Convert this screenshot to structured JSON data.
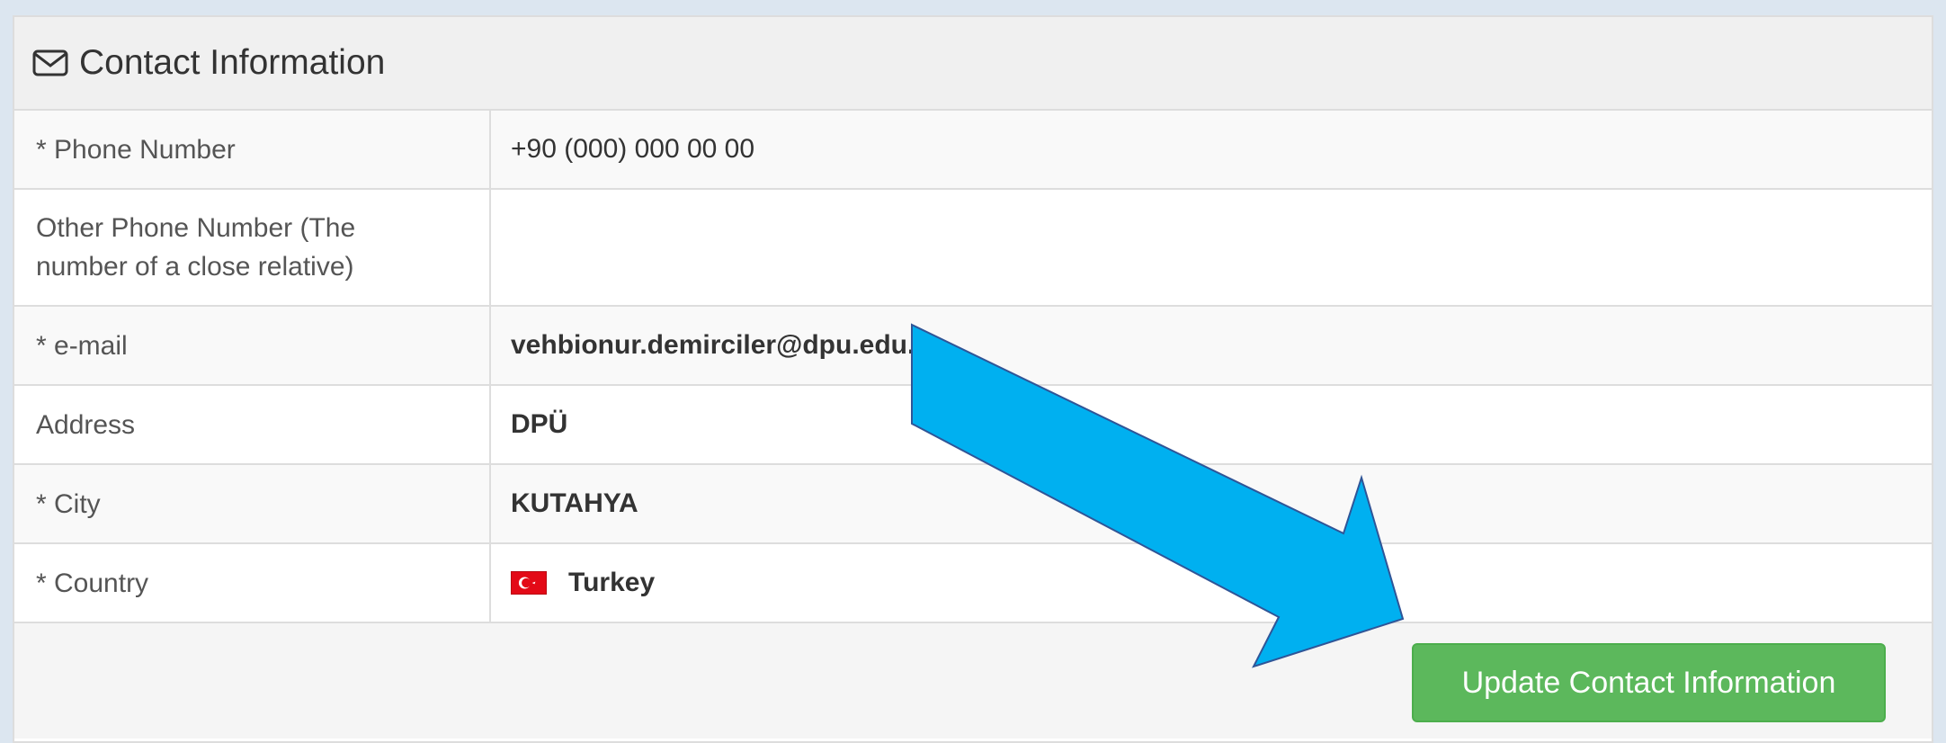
{
  "panel": {
    "title": "Contact Information",
    "icon": "envelope-icon"
  },
  "rows": [
    {
      "label": "* Phone Number",
      "value": "+90 (000) 000 00 00"
    },
    {
      "label": "Other Phone Number (The number of a close relative)",
      "value": ""
    },
    {
      "label": "* e-mail",
      "value": "vehbionur.demirciler@dpu.edu.tr"
    },
    {
      "label": "Address",
      "value": "DPÜ"
    },
    {
      "label": "* City",
      "value": "KUTAHYA"
    },
    {
      "label": "* Country",
      "value": "Turkey",
      "flag_icon": "turkey-flag-icon"
    }
  ],
  "footer": {
    "update_label": "Update Contact Information"
  },
  "colors": {
    "button_green": "#5cb85c",
    "arrow_blue": "#00b0f0"
  }
}
